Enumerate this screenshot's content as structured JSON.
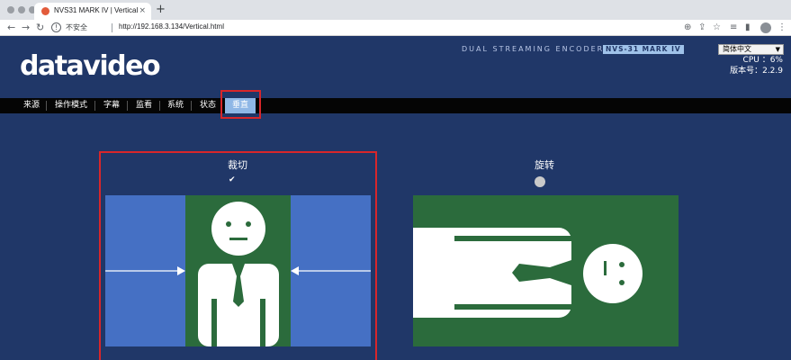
{
  "browser": {
    "tab_title": "NVS31 MARK IV | Vertical",
    "tab_close": "×",
    "new_tab": "+",
    "insecure_label": "不安全",
    "url": "http://192.168.3.134/Vertical.html"
  },
  "header": {
    "logo": "datavideo",
    "product_line": "DUAL STREAMING ENCODER",
    "model": "NVS-31 MARK IV",
    "language": "简体中文",
    "cpu": "CPU ：6%",
    "version": "版本号：2.2.9"
  },
  "menu": {
    "items": [
      "来源",
      "操作模式",
      "字幕",
      "监看",
      "系统",
      "状态"
    ],
    "active": "垂直"
  },
  "options": {
    "crop": {
      "title": "裁切",
      "selected": true,
      "check": "✔"
    },
    "rotate": {
      "title": "旋转",
      "selected": false
    }
  },
  "colors": {
    "page_bg": "#203768",
    "menu_bg": "#050505",
    "active_tab": "#8fb7e6",
    "highlight": "#d8262a",
    "panel_blue": "#4570c4",
    "panel_green": "#2b6b3c"
  },
  "icons": {
    "back": "arrow-left-icon",
    "forward": "arrow-right-icon",
    "reload": "reload-icon",
    "warning": "warning-icon",
    "zoom": "zoom-icon",
    "share": "share-icon",
    "bookmark": "star-icon",
    "menu": "more-icon"
  }
}
